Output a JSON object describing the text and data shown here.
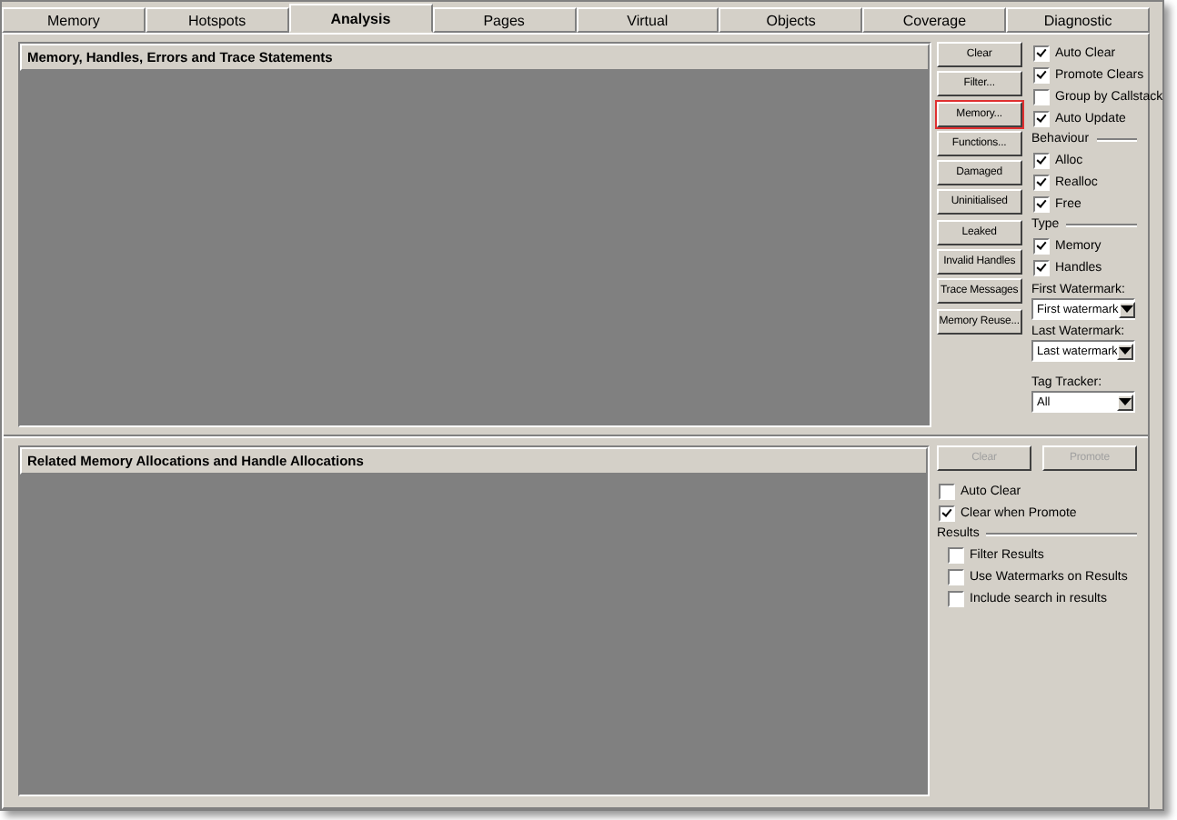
{
  "tabs": [
    {
      "label": "Memory",
      "selected": false
    },
    {
      "label": "Hotspots",
      "selected": false
    },
    {
      "label": "Analysis",
      "selected": true
    },
    {
      "label": "Pages",
      "selected": false
    },
    {
      "label": "Virtual",
      "selected": false
    },
    {
      "label": "Objects",
      "selected": false
    },
    {
      "label": "Coverage",
      "selected": false
    },
    {
      "label": "Diagnostic",
      "selected": false
    }
  ],
  "top_panel": {
    "title": "Memory, Handles, Errors and Trace Statements",
    "buttons": [
      {
        "label": "Clear",
        "highlighted": false
      },
      {
        "label": "Filter...",
        "highlighted": false
      },
      {
        "label": "Memory...",
        "highlighted": true
      },
      {
        "label": "Functions...",
        "highlighted": false
      },
      {
        "label": "Damaged",
        "highlighted": false
      },
      {
        "label": "Uninitialised",
        "highlighted": false
      },
      {
        "label": "Leaked",
        "highlighted": false
      },
      {
        "label": "Invalid Handles",
        "highlighted": false
      },
      {
        "label": "Trace Messages",
        "highlighted": false
      },
      {
        "label": "Memory Reuse...",
        "highlighted": false
      }
    ],
    "options": [
      {
        "label": "Auto Clear",
        "checked": true
      },
      {
        "label": "Promote Clears",
        "checked": true
      },
      {
        "label": "Group by Callstack",
        "checked": false
      },
      {
        "label": "Auto Update",
        "checked": true
      }
    ],
    "behaviour": {
      "title": "Behaviour",
      "options": [
        {
          "label": "Alloc",
          "checked": true
        },
        {
          "label": "Realloc",
          "checked": true
        },
        {
          "label": "Free",
          "checked": true
        }
      ]
    },
    "type": {
      "title": "Type",
      "options": [
        {
          "label": "Memory",
          "checked": true
        },
        {
          "label": "Handles",
          "checked": true
        }
      ]
    },
    "dropdowns": [
      {
        "label": "First Watermark:",
        "value": "First watermark"
      },
      {
        "label": "Last Watermark:",
        "value": "Last watermark"
      },
      {
        "label": "Tag Tracker:",
        "value": "All"
      }
    ]
  },
  "bottom_panel": {
    "title": "Related Memory Allocations and Handle Allocations",
    "buttons": [
      {
        "label": "Clear",
        "disabled": true
      },
      {
        "label": "Promote",
        "disabled": true
      }
    ],
    "options": [
      {
        "label": "Auto Clear",
        "checked": false
      },
      {
        "label": "Clear when Promote",
        "checked": true
      }
    ],
    "results": {
      "title": "Results",
      "options": [
        {
          "label": "Filter Results",
          "checked": false
        },
        {
          "label": "Use Watermarks on Results",
          "checked": false
        },
        {
          "label": "Include search in results",
          "checked": false
        }
      ]
    }
  }
}
